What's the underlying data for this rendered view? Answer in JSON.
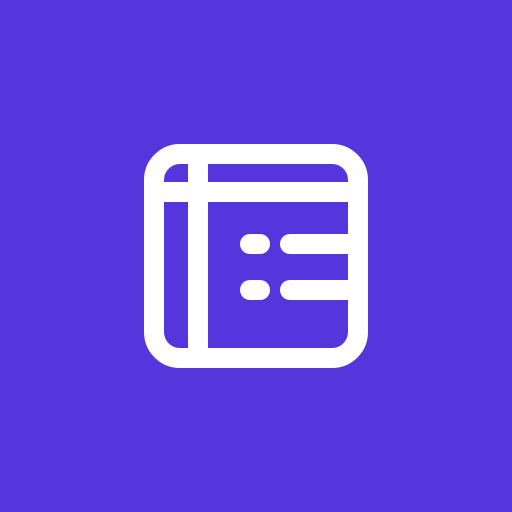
{
  "background_color": "#5536DC",
  "icon": {
    "name": "form-layout-icon",
    "color": "#FFFFFF"
  }
}
